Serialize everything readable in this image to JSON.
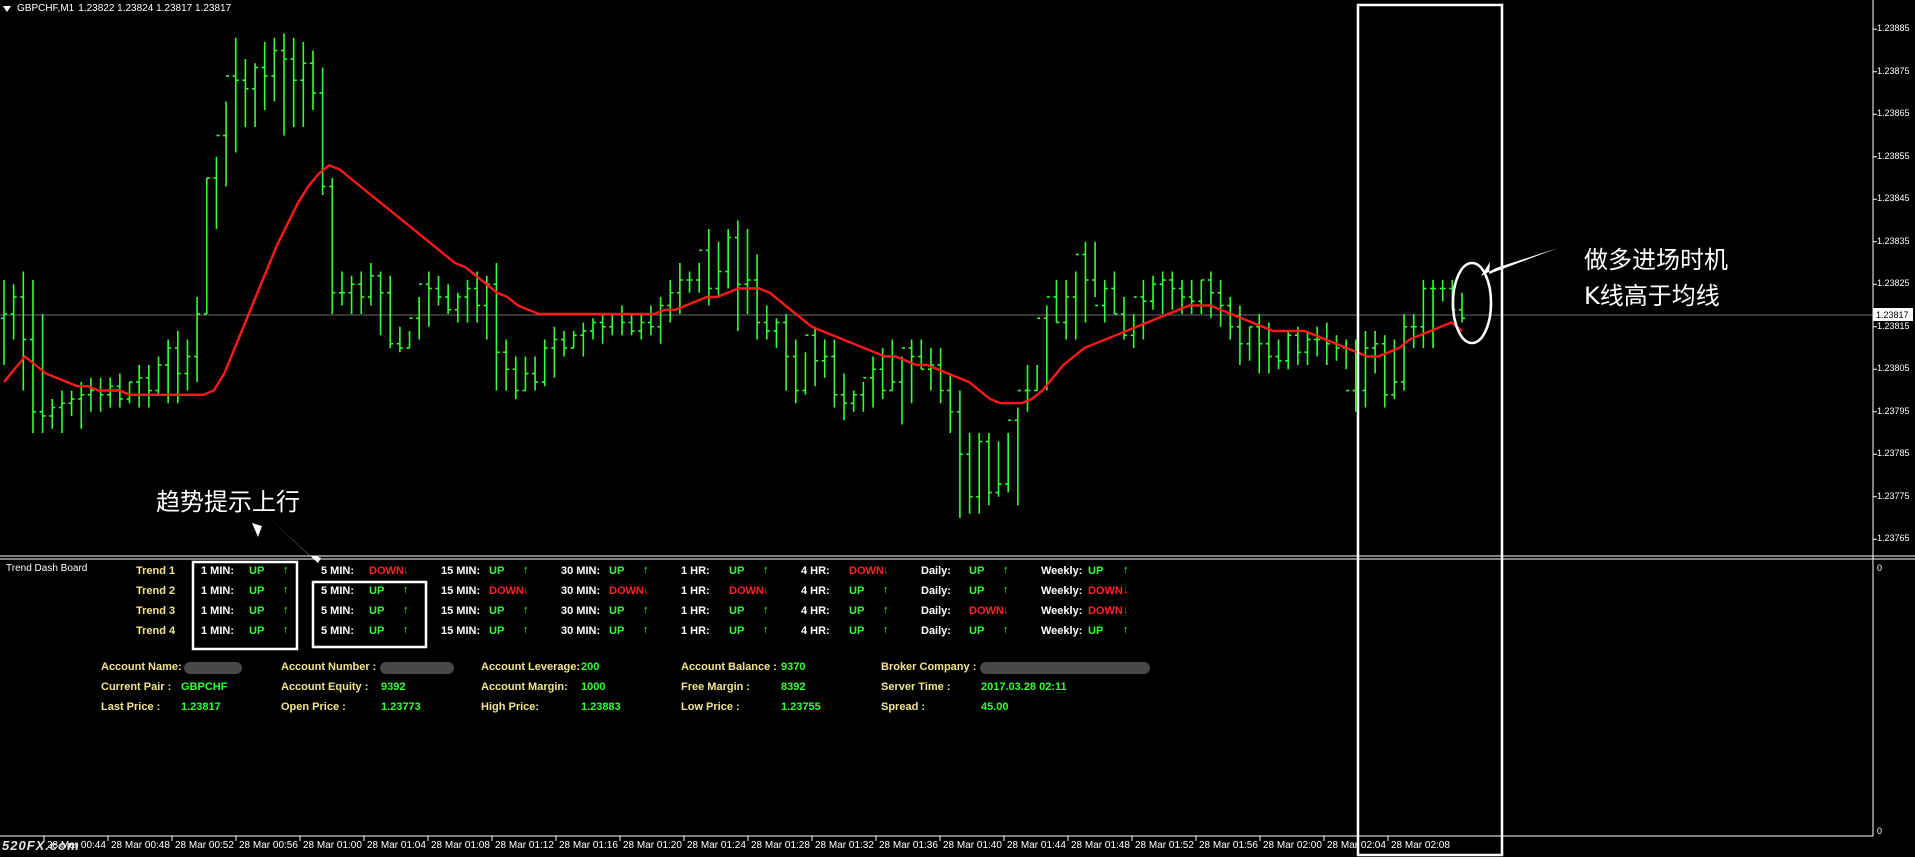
{
  "chart_header": {
    "symbol": "GBPCHF,M1",
    "prices": "1.23822 1.23824 1.23817 1.23817"
  },
  "indicator_title": "Trend Dash Board",
  "price_scale": {
    "labels": [
      "1.23885",
      "1.23875",
      "1.23865",
      "1.23855",
      "1.23845",
      "1.23835",
      "1.23825",
      "1.23815",
      "1.23805",
      "1.23795",
      "1.23785",
      "1.23775",
      "1.23765"
    ],
    "current": "1.23817",
    "subwindow_top": "0",
    "subwindow_bottom": "0"
  },
  "time_axis": [
    "28 Mar 00:44",
    "28 Mar 00:48",
    "28 Mar 00:52",
    "28 Mar 00:56",
    "28 Mar 01:00",
    "28 Mar 01:04",
    "28 Mar 01:08",
    "28 Mar 01:12",
    "28 Mar 01:16",
    "28 Mar 01:20",
    "28 Mar 01:24",
    "28 Mar 01:28",
    "28 Mar 01:32",
    "28 Mar 01:36",
    "28 Mar 01:40",
    "28 Mar 01:44",
    "28 Mar 01:48",
    "28 Mar 01:52",
    "28 Mar 01:56",
    "28 Mar 02:00",
    "28 Mar 02:04",
    "28 Mar 02:08"
  ],
  "watermark": "520FX.com",
  "annotations": {
    "right_line1": "做多进场时机",
    "right_line2": "K线高于均线",
    "left": "趋势提示上行"
  },
  "colors": {
    "bull_bar": "#33ff33",
    "ma_line": "#ff1a1a",
    "up_text": "#33ff33",
    "down_text": "#ff2222",
    "label_text": "#f0e68c"
  },
  "dashboard": {
    "trend_labels": [
      "Trend 1",
      "Trend 2",
      "Trend 3",
      "Trend 4"
    ],
    "timeframes": [
      "1 MIN:",
      "5 MIN:",
      "15 MIN:",
      "30 MIN:",
      "1 HR:",
      "4 HR:",
      "Daily:",
      "Weekly:"
    ],
    "up_text": "UP",
    "down_text": "DOWN",
    "up_arrow": "↑",
    "down_arrow": "↓",
    "states": [
      [
        "UP",
        "DOWN",
        "UP",
        "UP",
        "UP",
        "DOWN",
        "UP",
        "UP"
      ],
      [
        "UP",
        "UP",
        "DOWN",
        "DOWN",
        "DOWN",
        "UP",
        "UP",
        "DOWN"
      ],
      [
        "UP",
        "UP",
        "UP",
        "UP",
        "UP",
        "UP",
        "DOWN",
        "DOWN"
      ],
      [
        "UP",
        "UP",
        "UP",
        "UP",
        "UP",
        "UP",
        "UP",
        "UP"
      ]
    ]
  },
  "account": {
    "rows": [
      [
        {
          "label": "Account Name:",
          "value": ""
        },
        {
          "label": "Account Number :",
          "value": ""
        },
        {
          "label": "Account Leverage:",
          "value": "200"
        },
        {
          "label": "Account Balance :",
          "value": "9370"
        },
        {
          "label": "Broker Company :",
          "value": ""
        }
      ],
      [
        {
          "label": "Current Pair :",
          "value": "GBPCHF"
        },
        {
          "label": "Account Equity :",
          "value": "9392"
        },
        {
          "label": "Account Margin:",
          "value": "1000"
        },
        {
          "label": "Free Margin :",
          "value": "8392"
        },
        {
          "label": "Server Time :",
          "value": "2017.03.28 02:11"
        }
      ],
      [
        {
          "label": "Last Price :",
          "value": "1.23817"
        },
        {
          "label": "Open Price :",
          "value": "1.23773"
        },
        {
          "label": "High Price:",
          "value": "1.23883"
        },
        {
          "label": "Low Price :",
          "value": "1.23755"
        },
        {
          "label": "Spread :",
          "value": "45.00"
        }
      ]
    ]
  },
  "chart_data": {
    "type": "ohlc",
    "series": [
      {
        "name": "GBPCHF,M1",
        "o": [
          1.23817,
          1.23818,
          1.23822,
          1.23812,
          1.23795,
          1.23794,
          1.23796,
          1.23797,
          1.23798,
          1.23799,
          1.238,
          1.23799,
          1.23801,
          1.23798,
          1.23802,
          1.23803,
          1.238,
          1.23806,
          1.2381,
          1.23804,
          1.23808,
          1.23818,
          1.2385,
          1.2386,
          1.23874,
          1.23873,
          1.23871,
          1.23876,
          1.23874,
          1.2388,
          1.23878,
          1.23873,
          1.23877,
          1.2387,
          1.23848,
          1.23823,
          1.23823,
          1.23825,
          1.23822,
          1.23827,
          1.23823,
          1.23811,
          1.2381,
          1.23817,
          1.23825,
          1.23824,
          1.23822,
          1.23819,
          1.23822,
          1.23824,
          1.2382,
          1.23825,
          1.23809,
          1.23805,
          1.238,
          1.23804,
          1.23802,
          1.2381,
          1.23812,
          1.2381,
          1.23813,
          1.23814,
          1.23816,
          1.23815,
          1.23818,
          1.23816,
          1.23814,
          1.23816,
          1.23815,
          1.2382,
          1.23823,
          1.23826,
          1.23826,
          1.23833,
          1.23824,
          1.23828,
          1.23836,
          1.23825,
          1.23826,
          1.23816,
          1.23814,
          1.23816,
          1.23808,
          1.238,
          1.23813,
          1.23807,
          1.23808,
          1.23799,
          1.23797,
          1.23799,
          1.23803,
          1.23805,
          1.238,
          1.23802,
          1.2381,
          1.23808,
          1.23805,
          1.23806,
          1.238,
          1.23795,
          1.23785,
          1.23775,
          1.23788,
          1.23776,
          1.23778,
          1.23793,
          1.238,
          1.238,
          1.23817,
          1.23822,
          1.23816,
          1.23822,
          1.23832,
          1.23826,
          1.2382,
          1.23824,
          1.23818,
          1.23813,
          1.23822,
          1.23821,
          1.23825,
          1.23826,
          1.23824,
          1.23822,
          1.23821,
          1.23826,
          1.23823,
          1.2382,
          1.23815,
          1.23811,
          1.23815,
          1.23811,
          1.23808,
          1.23807,
          1.23813,
          1.23809,
          1.23812,
          1.23812,
          1.23811,
          1.2381,
          1.238,
          1.238,
          1.2381,
          1.23811,
          1.23799,
          1.23802,
          1.23815,
          1.23815,
          1.23824,
          1.23824,
          1.23824,
          1.23819
        ],
        "h": [
          1.23826,
          1.23825,
          1.23828,
          1.23826,
          1.23818,
          1.23798,
          1.238,
          1.238,
          1.23802,
          1.23803,
          1.23803,
          1.23803,
          1.23804,
          1.23802,
          1.23806,
          1.23806,
          1.23808,
          1.23812,
          1.23814,
          1.23812,
          1.23822,
          1.2385,
          1.23855,
          1.23868,
          1.23883,
          1.23878,
          1.23877,
          1.23882,
          1.23883,
          1.23884,
          1.23883,
          1.23882,
          1.2388,
          1.23876,
          1.2385,
          1.23828,
          1.23827,
          1.23828,
          1.2383,
          1.23828,
          1.23827,
          1.23815,
          1.23814,
          1.23822,
          1.23828,
          1.23827,
          1.23825,
          1.23823,
          1.23826,
          1.23828,
          1.23827,
          1.2383,
          1.23812,
          1.23808,
          1.23808,
          1.23808,
          1.23812,
          1.23815,
          1.23814,
          1.23814,
          1.23816,
          1.23817,
          1.23818,
          1.23818,
          1.2382,
          1.23818,
          1.23818,
          1.2382,
          1.23822,
          1.23826,
          1.2383,
          1.23828,
          1.2383,
          1.23838,
          1.23835,
          1.23838,
          1.2384,
          1.23838,
          1.23832,
          1.2382,
          1.23817,
          1.23818,
          1.23812,
          1.23809,
          1.23815,
          1.23812,
          1.23812,
          1.23804,
          1.238,
          1.23802,
          1.23808,
          1.2381,
          1.23812,
          1.23808,
          1.23812,
          1.23812,
          1.2381,
          1.2381,
          1.23804,
          1.238,
          1.2379,
          1.2379,
          1.2379,
          1.23788,
          1.2379,
          1.23796,
          1.23806,
          1.23806,
          1.2382,
          1.23826,
          1.23826,
          1.23828,
          1.23835,
          1.23835,
          1.23826,
          1.23828,
          1.23822,
          1.23818,
          1.23826,
          1.23827,
          1.23828,
          1.23828,
          1.23826,
          1.23826,
          1.23826,
          1.23828,
          1.23826,
          1.23822,
          1.2382,
          1.23815,
          1.23818,
          1.23816,
          1.23812,
          1.23814,
          1.23815,
          1.23814,
          1.23815,
          1.23816,
          1.23813,
          1.23812,
          1.23812,
          1.23814,
          1.23814,
          1.23813,
          1.23812,
          1.23818,
          1.23818,
          1.23826,
          1.23826,
          1.23826,
          1.23826,
          1.23823
        ],
        "l": [
          1.23806,
          1.23812,
          1.238,
          1.2379,
          1.2379,
          1.23791,
          1.2379,
          1.23794,
          1.23791,
          1.23795,
          1.23795,
          1.23796,
          1.23796,
          1.23797,
          1.23796,
          1.23796,
          1.23799,
          1.23797,
          1.23797,
          1.238,
          1.23802,
          1.23818,
          1.23838,
          1.23848,
          1.23856,
          1.23862,
          1.23862,
          1.23866,
          1.23868,
          1.2386,
          1.23862,
          1.23862,
          1.23866,
          1.23846,
          1.23818,
          1.2382,
          1.23818,
          1.23818,
          1.2382,
          1.23813,
          1.2381,
          1.23809,
          1.2381,
          1.23812,
          1.23815,
          1.2382,
          1.23818,
          1.23816,
          1.23816,
          1.23816,
          1.23812,
          1.238,
          1.238,
          1.23798,
          1.238,
          1.238,
          1.23801,
          1.23803,
          1.23808,
          1.2381,
          1.23808,
          1.23812,
          1.23811,
          1.23813,
          1.23813,
          1.23813,
          1.23812,
          1.23813,
          1.23811,
          1.23816,
          1.23818,
          1.23823,
          1.23823,
          1.2382,
          1.23822,
          1.23824,
          1.23814,
          1.23818,
          1.23812,
          1.23812,
          1.2381,
          1.238,
          1.23797,
          1.23799,
          1.23801,
          1.23803,
          1.23796,
          1.23793,
          1.23795,
          1.23795,
          1.23796,
          1.23798,
          1.238,
          1.23792,
          1.23797,
          1.23805,
          1.238,
          1.23797,
          1.2379,
          1.2377,
          1.23771,
          1.23771,
          1.23773,
          1.23775,
          1.23776,
          1.23773,
          1.23795,
          1.238,
          1.238,
          1.23816,
          1.23812,
          1.23812,
          1.23816,
          1.23822,
          1.23816,
          1.23818,
          1.23812,
          1.2381,
          1.23812,
          1.23819,
          1.23818,
          1.23819,
          1.23818,
          1.23818,
          1.23818,
          1.23817,
          1.23815,
          1.23812,
          1.23806,
          1.23807,
          1.23804,
          1.23804,
          1.23805,
          1.23805,
          1.23806,
          1.23806,
          1.23808,
          1.23806,
          1.23807,
          1.23805,
          1.23795,
          1.23796,
          1.23804,
          1.23796,
          1.23798,
          1.238,
          1.2381,
          1.2381,
          1.2381,
          1.23821,
          1.23819,
          1.23816
        ],
        "c": [
          1.23818,
          1.23822,
          1.23812,
          1.23795,
          1.23794,
          1.23796,
          1.23797,
          1.23798,
          1.23799,
          1.238,
          1.23799,
          1.23801,
          1.23798,
          1.23802,
          1.23803,
          1.238,
          1.23806,
          1.2381,
          1.23804,
          1.23808,
          1.23818,
          1.2385,
          1.2386,
          1.23874,
          1.23873,
          1.23871,
          1.23876,
          1.23874,
          1.2388,
          1.23878,
          1.23873,
          1.23877,
          1.2387,
          1.23848,
          1.23823,
          1.23823,
          1.23825,
          1.23822,
          1.23827,
          1.23823,
          1.23811,
          1.2381,
          1.23817,
          1.23825,
          1.23824,
          1.23822,
          1.23819,
          1.23822,
          1.23824,
          1.2382,
          1.23825,
          1.23809,
          1.23805,
          1.238,
          1.23804,
          1.23802,
          1.2381,
          1.23812,
          1.2381,
          1.23813,
          1.23814,
          1.23816,
          1.23815,
          1.23818,
          1.23816,
          1.23814,
          1.23816,
          1.23815,
          1.2382,
          1.23823,
          1.23826,
          1.23826,
          1.23833,
          1.23824,
          1.23828,
          1.23836,
          1.23825,
          1.23826,
          1.23816,
          1.23814,
          1.23816,
          1.23808,
          1.238,
          1.23813,
          1.23807,
          1.23808,
          1.23799,
          1.23797,
          1.23799,
          1.23803,
          1.23805,
          1.238,
          1.23802,
          1.2381,
          1.23808,
          1.23805,
          1.23806,
          1.238,
          1.23795,
          1.23785,
          1.23775,
          1.23788,
          1.23776,
          1.23778,
          1.23793,
          1.238,
          1.238,
          1.23817,
          1.23822,
          1.23816,
          1.23822,
          1.23832,
          1.23826,
          1.2382,
          1.23824,
          1.23818,
          1.23813,
          1.23822,
          1.23821,
          1.23825,
          1.23826,
          1.23824,
          1.23822,
          1.23821,
          1.23826,
          1.23823,
          1.2382,
          1.23815,
          1.23811,
          1.23815,
          1.23811,
          1.23808,
          1.23807,
          1.23813,
          1.23809,
          1.23812,
          1.23812,
          1.23811,
          1.2381,
          1.238,
          1.238,
          1.2381,
          1.23811,
          1.23799,
          1.23802,
          1.23815,
          1.23815,
          1.23824,
          1.23824,
          1.23824,
          1.23819,
          1.23817
        ]
      },
      {
        "name": "MA",
        "values": [
          1.23802,
          1.23805,
          1.23808,
          1.23806,
          1.23804,
          1.23803,
          1.23802,
          1.23801,
          1.23801,
          1.238,
          1.238,
          1.238,
          1.23799,
          1.23799,
          1.23799,
          1.23799,
          1.23799,
          1.23799,
          1.23799,
          1.23799,
          1.238,
          1.23804,
          1.2381,
          1.23816,
          1.23822,
          1.23828,
          1.23834,
          1.23839,
          1.23844,
          1.23848,
          1.23851,
          1.23853,
          1.23852,
          1.2385,
          1.23848,
          1.23846,
          1.23844,
          1.23842,
          1.2384,
          1.23838,
          1.23836,
          1.23834,
          1.23832,
          1.2383,
          1.23829,
          1.23827,
          1.23825,
          1.23823,
          1.23822,
          1.2382,
          1.23819,
          1.23818,
          1.23818,
          1.23818,
          1.23818,
          1.23818,
          1.23818,
          1.23818,
          1.23818,
          1.23818,
          1.23818,
          1.23818,
          1.23818,
          1.23819,
          1.23819,
          1.2382,
          1.23821,
          1.23822,
          1.23822,
          1.23823,
          1.23824,
          1.23824,
          1.23824,
          1.23823,
          1.23821,
          1.23819,
          1.23817,
          1.23815,
          1.23814,
          1.23813,
          1.23812,
          1.23811,
          1.2381,
          1.23809,
          1.23808,
          1.23808,
          1.23807,
          1.23806,
          1.23806,
          1.23805,
          1.23804,
          1.23803,
          1.23802,
          1.238,
          1.23798,
          1.23797,
          1.23797,
          1.23797,
          1.23798,
          1.238,
          1.23803,
          1.23806,
          1.23808,
          1.2381,
          1.23811,
          1.23812,
          1.23813,
          1.23814,
          1.23815,
          1.23816,
          1.23817,
          1.23818,
          1.23819,
          1.2382,
          1.2382,
          1.2382,
          1.23819,
          1.23818,
          1.23817,
          1.23816,
          1.23815,
          1.23814,
          1.23814,
          1.23814,
          1.23814,
          1.23813,
          1.23812,
          1.23811,
          1.2381,
          1.23809,
          1.23808,
          1.23808,
          1.23809,
          1.2381,
          1.23812,
          1.23813,
          1.23814,
          1.23815,
          1.23816,
          1.23814
        ]
      }
    ],
    "ylim": [
      1.23762,
      1.2389
    ],
    "grid": false
  }
}
